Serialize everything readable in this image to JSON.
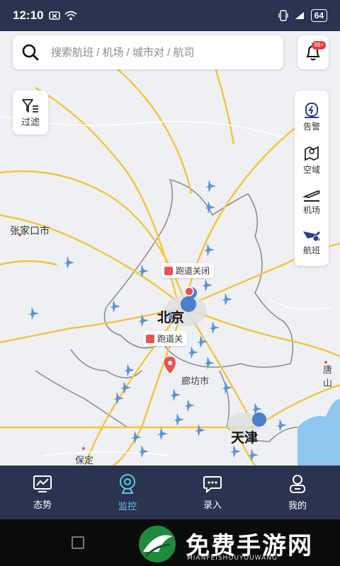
{
  "status_bar": {
    "time": "12:10",
    "battery": "64"
  },
  "search": {
    "placeholder": "搜索航班 / 机场 / 城市对 / 航司"
  },
  "notifications": {
    "badge": "99+"
  },
  "filter": {
    "label": "过滤"
  },
  "side_panel": {
    "items": [
      {
        "label": "告警",
        "icon": "alert-icon"
      },
      {
        "label": "空域",
        "icon": "airspace-icon"
      },
      {
        "label": "机场",
        "icon": "airport-icon"
      },
      {
        "label": "航班",
        "icon": "flight-icon"
      }
    ]
  },
  "map": {
    "cities": {
      "zhangjiakou": "张家口市",
      "beijing": "北京",
      "langfang": "廊坊市",
      "tianjin": "天津",
      "baoding": "保定",
      "tangshan": "唐山"
    },
    "callouts": {
      "runway_closed_1": "跑道关闭",
      "runway_closed_2": "跑道关"
    }
  },
  "bottom_nav": {
    "items": [
      {
        "label": "态势",
        "active": false
      },
      {
        "label": "监控",
        "active": true
      },
      {
        "label": "录入",
        "active": false
      },
      {
        "label": "我的",
        "active": false
      }
    ]
  },
  "watermark": {
    "title": "免费手游网",
    "subtitle": "MIANFEISHOUYOUWANG"
  },
  "colors": {
    "nav_bg": "#2a3350",
    "active": "#5fc7e6",
    "plane": "#5b93d3",
    "road": "#f3c53a"
  }
}
